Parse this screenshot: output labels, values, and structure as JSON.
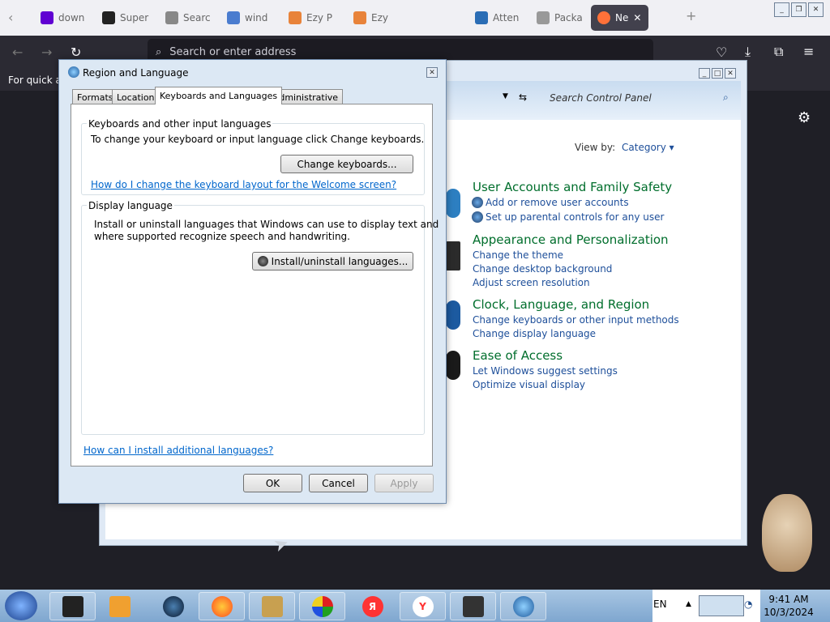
{
  "browser": {
    "tabs": [
      {
        "label": "down",
        "icon": "yahoo-icon",
        "color": "#6001d2"
      },
      {
        "label": "Super",
        "icon": "s-logo-icon",
        "color": "#222"
      },
      {
        "label": "Searc",
        "icon": "search-icon",
        "color": "#888"
      },
      {
        "label": "wind",
        "icon": "video-icon",
        "color": "#4a7ccf"
      },
      {
        "label": "Ezy P",
        "icon": "ezy-icon",
        "color": "#e8833a"
      },
      {
        "label": "Ezy",
        "icon": "ezy-icon",
        "color": "#e8833a"
      },
      {
        "label": "Atten",
        "icon": "atten-icon",
        "color": "#2a6db5"
      },
      {
        "label": "Packa",
        "icon": "package-icon",
        "color": "#999"
      }
    ],
    "active_tab": "Ne",
    "url_placeholder": "Search or enter address",
    "bookmarks_text": "For quick ac"
  },
  "control_panel": {
    "search_placeholder": "Search Control Panel",
    "view_by_label": "View by:",
    "view_by_value": "Category",
    "categories": [
      {
        "title": "User Accounts and Family Safety",
        "links": [
          "Add or remove user accounts",
          "Set up parental controls for any user"
        ]
      },
      {
        "title": "Appearance and Personalization",
        "links": [
          "Change the theme",
          "Change desktop background",
          "Adjust screen resolution"
        ]
      },
      {
        "title": "Clock, Language, and Region",
        "links": [
          "Change keyboards or other input methods",
          "Change display language"
        ]
      },
      {
        "title": "Ease of Access",
        "links": [
          "Let Windows suggest settings",
          "Optimize visual display"
        ]
      }
    ]
  },
  "dialog": {
    "title": "Region and Language",
    "tabs": [
      "Formats",
      "Location",
      "Keyboards and Languages",
      "Administrative"
    ],
    "active_tab": "Keyboards and Languages",
    "keyboards_group": {
      "label": "Keyboards and other input languages",
      "text": "To change your keyboard or input language click Change keyboards.",
      "button": "Change keyboards...",
      "link": "How do I change the keyboard layout for the Welcome screen?"
    },
    "display_group": {
      "label": "Display language",
      "text_line1": "Install or uninstall languages that Windows can use to display text and",
      "text_line2": "where supported recognize speech and handwriting.",
      "button": "Install/uninstall languages..."
    },
    "bottom_link": "How can I install additional languages?",
    "ok": "OK",
    "cancel": "Cancel",
    "apply": "Apply"
  },
  "taskbar": {
    "language": "EN",
    "time": "9:41 AM",
    "date": "10/3/2024"
  }
}
